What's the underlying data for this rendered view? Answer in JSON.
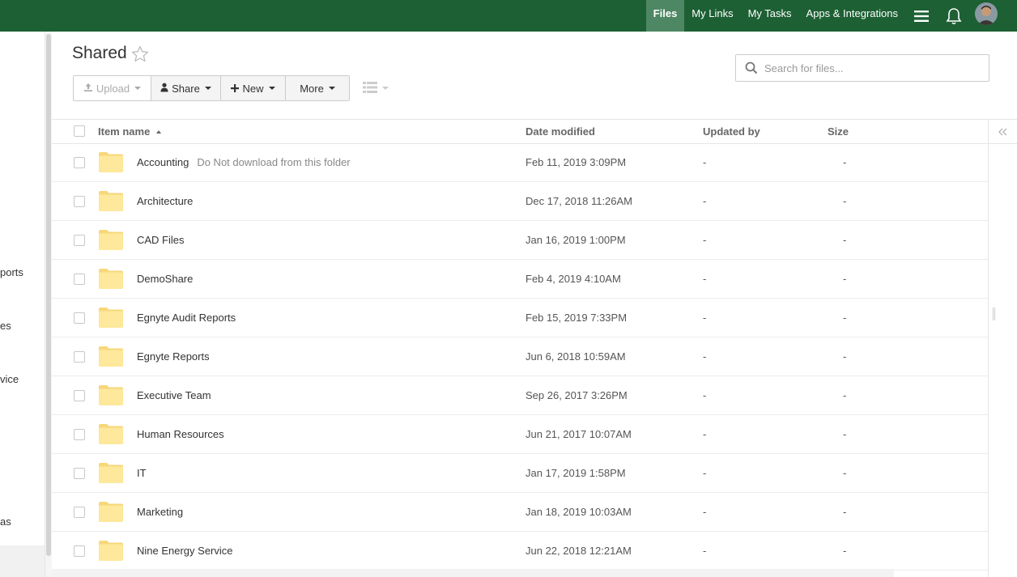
{
  "topnav": {
    "items": [
      {
        "label": "Files",
        "active": true
      },
      {
        "label": "My Links"
      },
      {
        "label": "My Tasks"
      },
      {
        "label": "Apps & Integrations"
      }
    ]
  },
  "sidebar": {
    "fragments": [
      "ports",
      "es",
      "vice",
      "as"
    ]
  },
  "page": {
    "title": "Shared"
  },
  "toolbar": {
    "upload_label": "Upload",
    "share_label": "Share",
    "new_label": "New",
    "more_label": "More"
  },
  "search": {
    "placeholder": "Search for files..."
  },
  "table": {
    "columns": {
      "name": "Item name",
      "date": "Date modified",
      "updated_by": "Updated by",
      "size": "Size"
    },
    "rows": [
      {
        "name": "Accounting",
        "note": "Do Not download from this folder",
        "date": "Feb 11, 2019 3:09PM",
        "updated_by": "-",
        "size": "-"
      },
      {
        "name": "Architecture",
        "note": "",
        "date": "Dec 17, 2018 11:26AM",
        "updated_by": "-",
        "size": "-"
      },
      {
        "name": "CAD Files",
        "note": "",
        "date": "Jan 16, 2019 1:00PM",
        "updated_by": "-",
        "size": "-"
      },
      {
        "name": "DemoShare",
        "note": "",
        "date": "Feb 4, 2019 4:10AM",
        "updated_by": "-",
        "size": "-"
      },
      {
        "name": "Egnyte Audit Reports",
        "note": "",
        "date": "Feb 15, 2019 7:33PM",
        "updated_by": "-",
        "size": "-"
      },
      {
        "name": "Egnyte Reports",
        "note": "",
        "date": "Jun 6, 2018 10:59AM",
        "updated_by": "-",
        "size": "-"
      },
      {
        "name": "Executive Team",
        "note": "",
        "date": "Sep 26, 2017 3:26PM",
        "updated_by": "-",
        "size": "-"
      },
      {
        "name": "Human Resources",
        "note": "",
        "date": "Jun 21, 2017 10:07AM",
        "updated_by": "-",
        "size": "-"
      },
      {
        "name": "IT",
        "note": "",
        "date": "Jan 17, 2019 1:58PM",
        "updated_by": "-",
        "size": "-"
      },
      {
        "name": "Marketing",
        "note": "",
        "date": "Jan 18, 2019 10:03AM",
        "updated_by": "-",
        "size": "-"
      },
      {
        "name": "Nine Energy Service",
        "note": "",
        "date": "Jun 22, 2018 12:21AM",
        "updated_by": "-",
        "size": "-"
      }
    ]
  },
  "colors": {
    "topbar": "#1d6034",
    "topbar_active": "#4e8763",
    "folder": "#fde89b"
  },
  "icons": [
    "star-icon",
    "upload-icon",
    "user-icon",
    "plus-icon",
    "list-view-icon",
    "search-icon",
    "menu-icon",
    "bell-icon",
    "avatar",
    "folder-icon",
    "collapse-panel-icon",
    "sort-asc-icon"
  ]
}
